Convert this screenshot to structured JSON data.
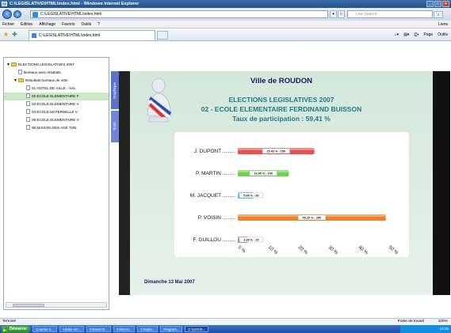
{
  "window": {
    "title": "C:\\LEGISLATIVE\\HTML\\index.html - Windows Internet Explorer"
  },
  "address": {
    "url": "C:\\LEGISLATIVE\\HTML\\index.html",
    "search_placeholder": "Live Search"
  },
  "menu": {
    "items": [
      "Fichier",
      "Edition",
      "Affichage",
      "Favoris",
      "Outils",
      "?"
    ],
    "links_label": "Liens"
  },
  "tab": {
    "label": "C:\\LEGISLATIVE\\HTML\\index.html"
  },
  "toolbar": {
    "page_label": "Page",
    "tools_label": "Outils"
  },
  "tree": {
    "root": "ELECTIONS LEGISLATIVES 2007",
    "bureaux": "Bureaux avec résultats",
    "resultats": "Résultats bureaux de vote",
    "items": [
      "01 HOTEL DE VILLE - SAL",
      "02 ECOLE ELEMENTAIRE F",
      "03 ECOLE ELEMENTAIRE V",
      "04 ECOLE MATERNELLE V",
      "05 ECOLE ELEMENTAIRE V",
      "06 MAISON DES ANS TON"
    ]
  },
  "sidetabs": {
    "graphique": "Graphique",
    "texte": "Texte"
  },
  "slide": {
    "city": "Ville de ROUDON",
    "title1": "ELECTIONS LEGISLATIVES 2007",
    "title2": "02 - ECOLE ELEMENTAIRE FERDINAND BUISSON",
    "title3": "Taux de participation : 59,41 %",
    "footer": "Dimanche 13 Mai 2007"
  },
  "chart_data": {
    "type": "bar",
    "orientation": "horizontal",
    "categories": [
      "J. DUPONT",
      "P. MARTIN",
      "M. JACQUET",
      "P. VOISIN",
      "F. GUILLOU"
    ],
    "values": [
      25.42,
      16.95,
      5.08,
      49.15,
      3.39
    ],
    "counts": [
      150,
      100,
      30,
      290,
      20
    ],
    "labels": [
      "25.42 % - 150",
      "16.95 % - 100",
      "5.08 % - 30",
      "49.15 % - 290",
      "3.39 % - 20"
    ],
    "colors": [
      "#e5534b",
      "#6bd34f",
      "#46c8e6",
      "#e8842a",
      "#e06ab0"
    ],
    "xticks": [
      "0 %",
      "10 %",
      "20 %",
      "30 %",
      "40 %",
      "50 %"
    ],
    "xlim": [
      0,
      50
    ]
  },
  "status": {
    "left": "Terminé",
    "zone": "Poste de travail",
    "zoom": "100%"
  },
  "taskbar": {
    "start": "Démarrer",
    "items": [
      "Courrier e...",
      "Adobe Acr...",
      "Intranet D...",
      "2 Micros...",
      "2 Explo...",
      "Program...",
      "C:\\LEGIS..."
    ],
    "clock": "14:26"
  }
}
